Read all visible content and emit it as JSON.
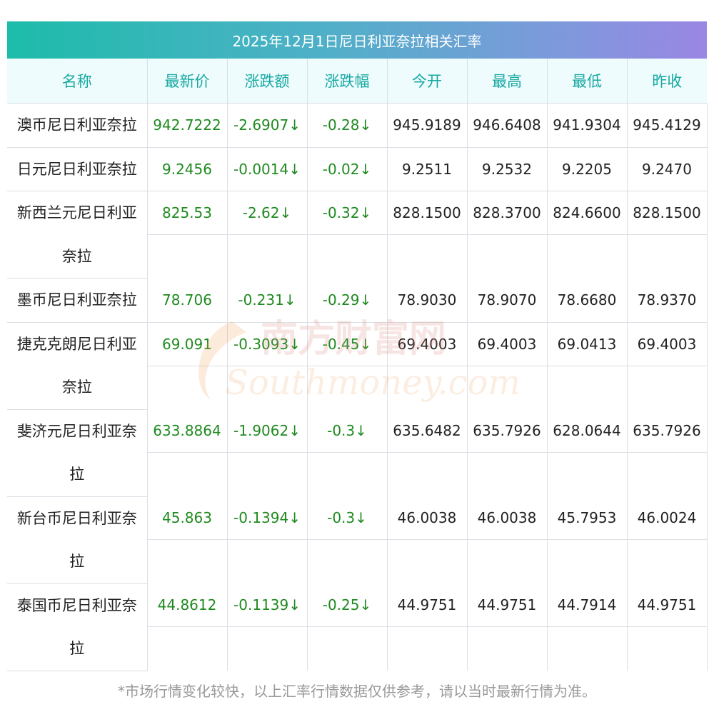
{
  "title": "2025年12月1日尼日利亚奈拉相关汇率",
  "columns": [
    "名称",
    "最新价",
    "涨跌额",
    "涨跌幅",
    "今开",
    "最高",
    "最低",
    "昨收"
  ],
  "rows": [
    {
      "name": "澳币尼日利亚奈拉",
      "latest": "942.7222",
      "change": "-2.6907↓",
      "pct": "-0.28↓",
      "open": "945.9189",
      "high": "946.6408",
      "low": "941.9304",
      "prev": "945.4129"
    },
    {
      "name": "日元尼日利亚奈拉",
      "latest": "9.2456",
      "change": "-0.0014↓",
      "pct": "-0.02↓",
      "open": "9.2511",
      "high": "9.2532",
      "low": "9.2205",
      "prev": "9.2470"
    },
    {
      "name": "新西兰元尼日利亚奈拉",
      "latest": "825.53",
      "change": "-2.62↓",
      "pct": "-0.32↓",
      "open": "828.1500",
      "high": "828.3700",
      "low": "824.6600",
      "prev": "828.1500"
    },
    {
      "name": "墨币尼日利亚奈拉",
      "latest": "78.706",
      "change": "-0.231↓",
      "pct": "-0.29↓",
      "open": "78.9030",
      "high": "78.9070",
      "low": "78.6680",
      "prev": "78.9370"
    },
    {
      "name": "捷克克朗尼日利亚奈拉",
      "latest": "69.091",
      "change": "-0.3093↓",
      "pct": "-0.45↓",
      "open": "69.4003",
      "high": "69.4003",
      "low": "69.0413",
      "prev": "69.4003"
    },
    {
      "name": "斐济元尼日利亚奈拉",
      "latest": "633.8864",
      "change": "-1.9062↓",
      "pct": "-0.3↓",
      "open": "635.6482",
      "high": "635.7926",
      "low": "628.0644",
      "prev": "635.7926"
    },
    {
      "name": "新台币尼日利亚奈拉",
      "latest": "45.863",
      "change": "-0.1394↓",
      "pct": "-0.3↓",
      "open": "46.0038",
      "high": "46.0038",
      "low": "45.7953",
      "prev": "46.0024"
    },
    {
      "name": "泰国币尼日利亚奈拉",
      "latest": "44.8612",
      "change": "-0.1139↓",
      "pct": "-0.25↓",
      "open": "44.9751",
      "high": "44.9751",
      "low": "44.7914",
      "prev": "44.9751"
    }
  ],
  "watermark": {
    "cn": "南方财富网",
    "en": "Southmoney.com"
  },
  "footnote": "*市场行情变化较快，以上汇率行情数据仅供参考，请以当时最新行情为准。",
  "colors": {
    "header_text": "#17a8a2",
    "header_bg": "#eefcfd",
    "value_green": "#1f8a1f",
    "title_gradient_start": "#1dbcaa",
    "title_gradient_end": "#9a86e4"
  }
}
